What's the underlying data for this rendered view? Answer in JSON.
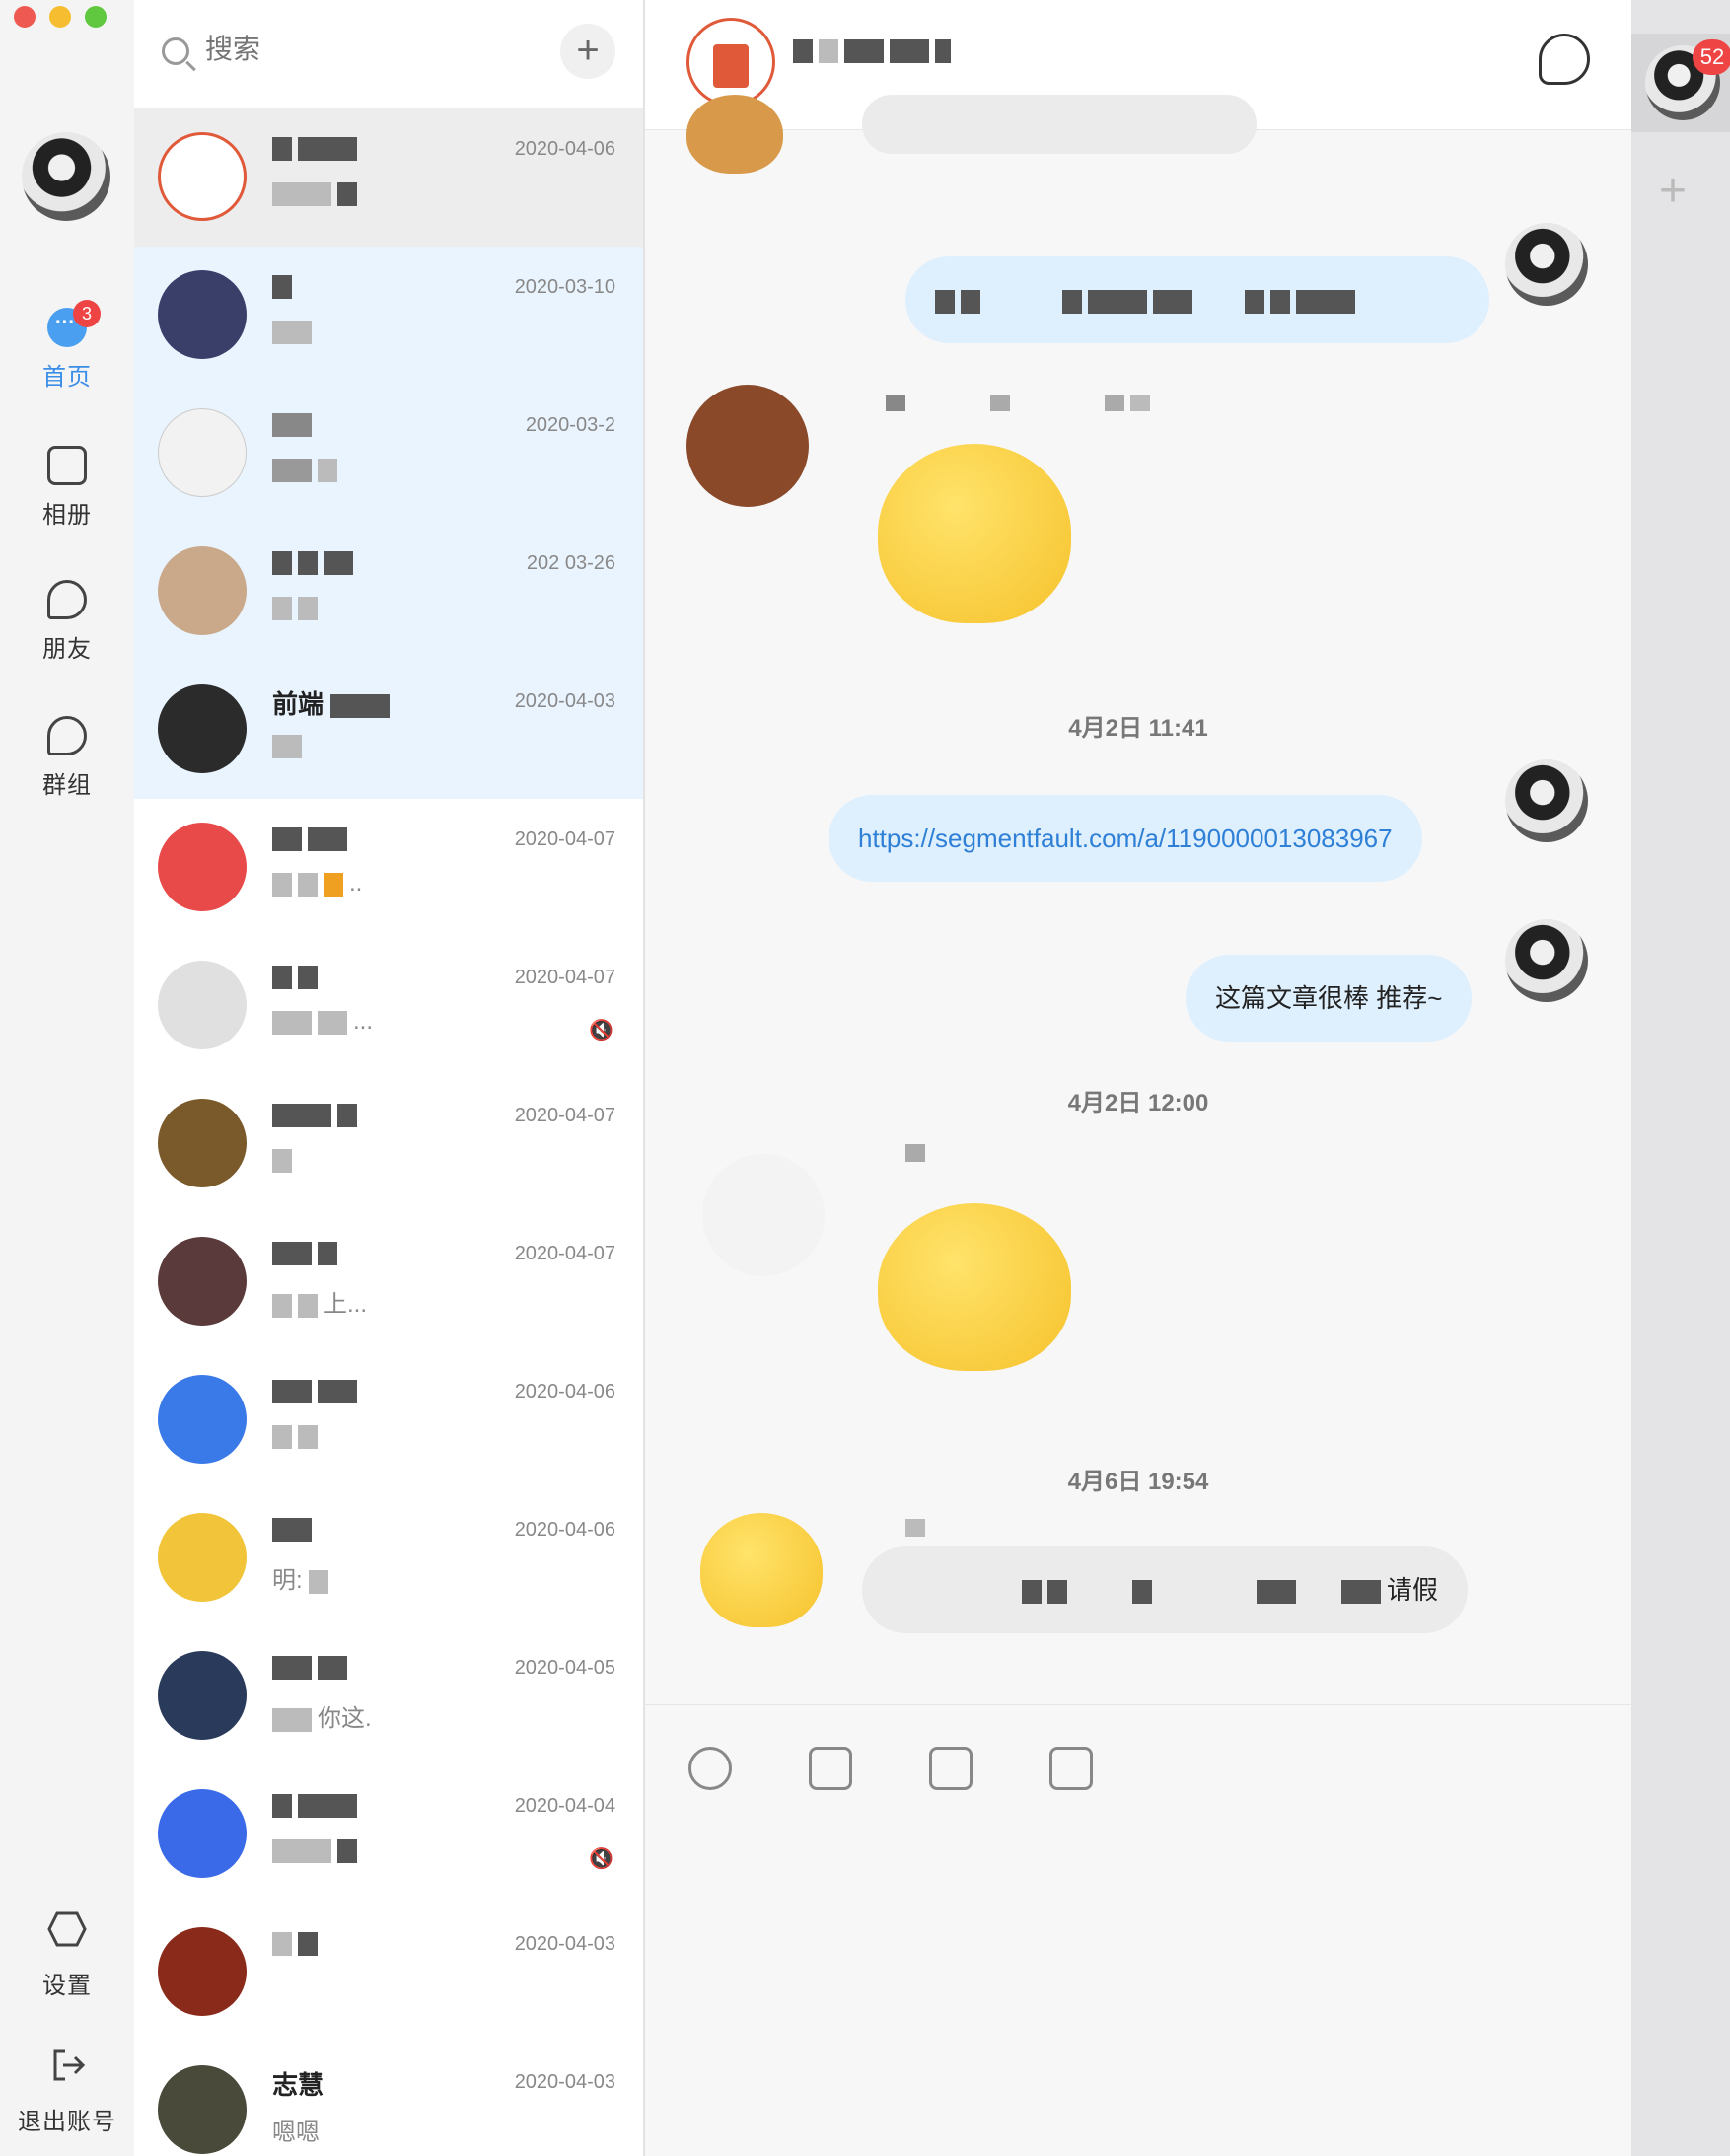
{
  "window": {
    "traffic_colors": [
      "#ee5a52",
      "#f5bd2f",
      "#5fc83f"
    ]
  },
  "nav": {
    "items": [
      {
        "label": "首页",
        "badge": "3",
        "icon": "chat-bubble-icon",
        "active": true
      },
      {
        "label": "相册",
        "icon": "album-icon"
      },
      {
        "label": "朋友",
        "icon": "friend-icon"
      },
      {
        "label": "群组",
        "icon": "group-icon"
      }
    ],
    "settings_label": "设置",
    "logout_label": "退出账号"
  },
  "search": {
    "placeholder": "搜索",
    "add_label": "+"
  },
  "conversations": [
    {
      "date": "2020-04-06"
    },
    {
      "date": "2020-03-10"
    },
    {
      "date": "2020-03-2"
    },
    {
      "date": "202 03-26"
    },
    {
      "date": "2020-04-03",
      "name_fragment": "前端"
    },
    {
      "date": "2020-04-07",
      "preview_suffix": ".."
    },
    {
      "date": "2020-04-07",
      "preview_suffix": "...",
      "muted": true
    },
    {
      "date": "2020-04-07"
    },
    {
      "date": "2020-04-07",
      "preview_suffix": "上..."
    },
    {
      "date": "2020-04-06"
    },
    {
      "date": "2020-04-06",
      "preview_fragment": "明:"
    },
    {
      "date": "2020-04-05",
      "preview_suffix": "你这."
    },
    {
      "date": "2020-04-04",
      "muted": true
    },
    {
      "date": "2020-04-03"
    },
    {
      "date": "2020-04-03",
      "name_fragment": "志慧",
      "preview_fragment": "嗯嗯"
    }
  ],
  "chat": {
    "time_dividers": [
      "4月2日 11:41",
      "4月2日 12:00",
      "4月6日 19:54"
    ],
    "messages": {
      "link": "https://segmentfault.com/a/1190000013083967",
      "recommend": "这篇文章很棒 推荐~",
      "leave_suffix": "请假"
    }
  },
  "right_strip": {
    "badge": "52",
    "add_label": "+"
  },
  "colors": {
    "accent": "#3b8ee8",
    "badge": "#ef4444",
    "bubble_me": "#deeffd",
    "bubble_other": "#ebebeb"
  }
}
